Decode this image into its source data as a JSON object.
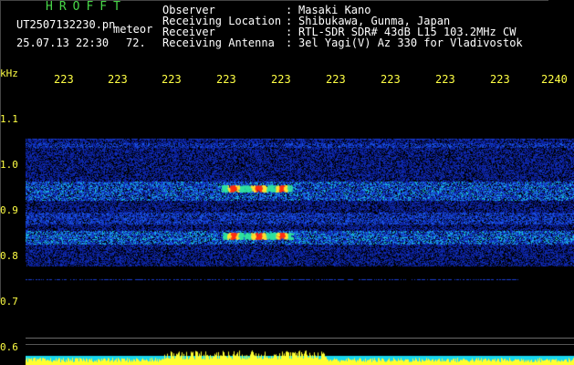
{
  "header": {
    "title": "HROFFT",
    "filename": "UT2507132230.pn",
    "mode": "meteor",
    "datetime": "25.07.13 22:30",
    "level": "72."
  },
  "info": [
    {
      "label": "Observer",
      "sep": ":",
      "value": "Masaki Kano"
    },
    {
      "label": "Receiving Location",
      "sep": ":",
      "value": "Shibukawa, Gunma, Japan"
    },
    {
      "label": "Receiver",
      "sep": ":",
      "value": "RTL-SDR SDR# 43dB L15 103.2MHz CW"
    },
    {
      "label": "Receiving Antenna",
      "sep": ":",
      "value": "3el Yagi(V) Az 330 for Vladivostok"
    }
  ],
  "x_axis": {
    "ticks": [
      "223",
      "223",
      "223",
      "223",
      "223",
      "223",
      "223",
      "223",
      "223",
      "2240"
    ]
  },
  "y_axis": {
    "unit": "kHz",
    "ticks": [
      "1.1",
      "1.0",
      "0.9",
      "0.8",
      "0.7",
      "0.6"
    ]
  },
  "colors": {
    "title": "#48d848",
    "tick": "#ffff44",
    "background": "#000000",
    "signal_low": "#0a1a8c",
    "signal_mid": "#18c0d8",
    "signal_high": "#ffe030",
    "signal_peak": "#ff3010",
    "level_strip_low": "#18d8f0",
    "level_strip_high": "#ffff30"
  }
}
